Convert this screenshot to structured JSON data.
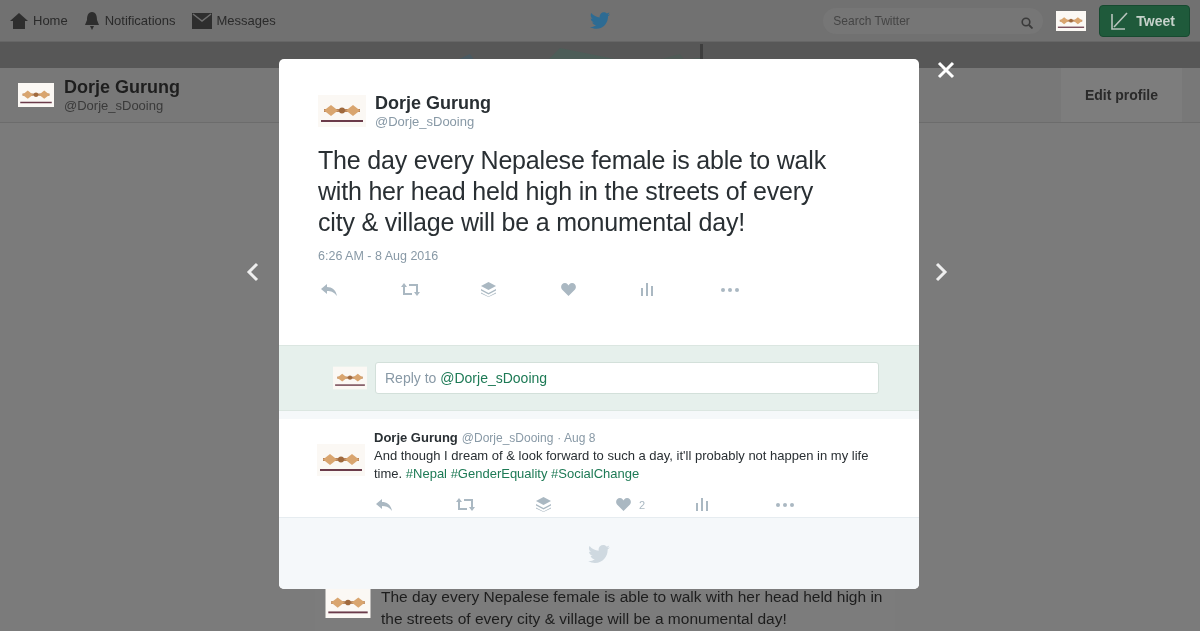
{
  "nav": {
    "items": [
      {
        "kind": "home",
        "label": "Home"
      },
      {
        "kind": "notifications",
        "label": "Notifications"
      },
      {
        "kind": "messages",
        "label": "Messages"
      }
    ],
    "search": {
      "placeholder": "Search Twitter"
    },
    "tweet_button": "Tweet"
  },
  "profile": {
    "name": "Dorje Gurung",
    "handle": "@Dorje_sDooing",
    "edit_button": "Edit profile"
  },
  "modal": {
    "tweet": {
      "name": "Dorje Gurung",
      "handle": "@Dorje_sDooing",
      "text": "The day every Nepalese female is able to walk with her head held high in the streets of every city & village will be a monumental day!",
      "timestamp": "6:26 AM - 8 Aug 2016",
      "actions": [
        {
          "kind": "reply"
        },
        {
          "kind": "retweet"
        },
        {
          "kind": "stack"
        },
        {
          "kind": "like"
        },
        {
          "kind": "stats"
        },
        {
          "kind": "more"
        }
      ]
    },
    "reply_field": {
      "prefix": "Reply to",
      "mention": "@Dorje_sDooing"
    },
    "replies": [
      {
        "name": "Dorje Gurung",
        "handle": "@Dorje_sDooing",
        "date": "· Aug 8",
        "text": "And though I dream of & look forward to such a day, it'll probably not happen in my life time.",
        "hashtags": [
          "#Nepal",
          "#GenderEquality",
          "#SocialChange"
        ],
        "actions": [
          {
            "kind": "reply"
          },
          {
            "kind": "retweet"
          },
          {
            "kind": "stack"
          },
          {
            "kind": "like",
            "count": "2"
          },
          {
            "kind": "stats"
          },
          {
            "kind": "more"
          }
        ]
      }
    ]
  },
  "background_tweet": {
    "text": "The day every Nepalese female is able to walk with her head held high in the streets of every city & village will be a monumental day!"
  }
}
